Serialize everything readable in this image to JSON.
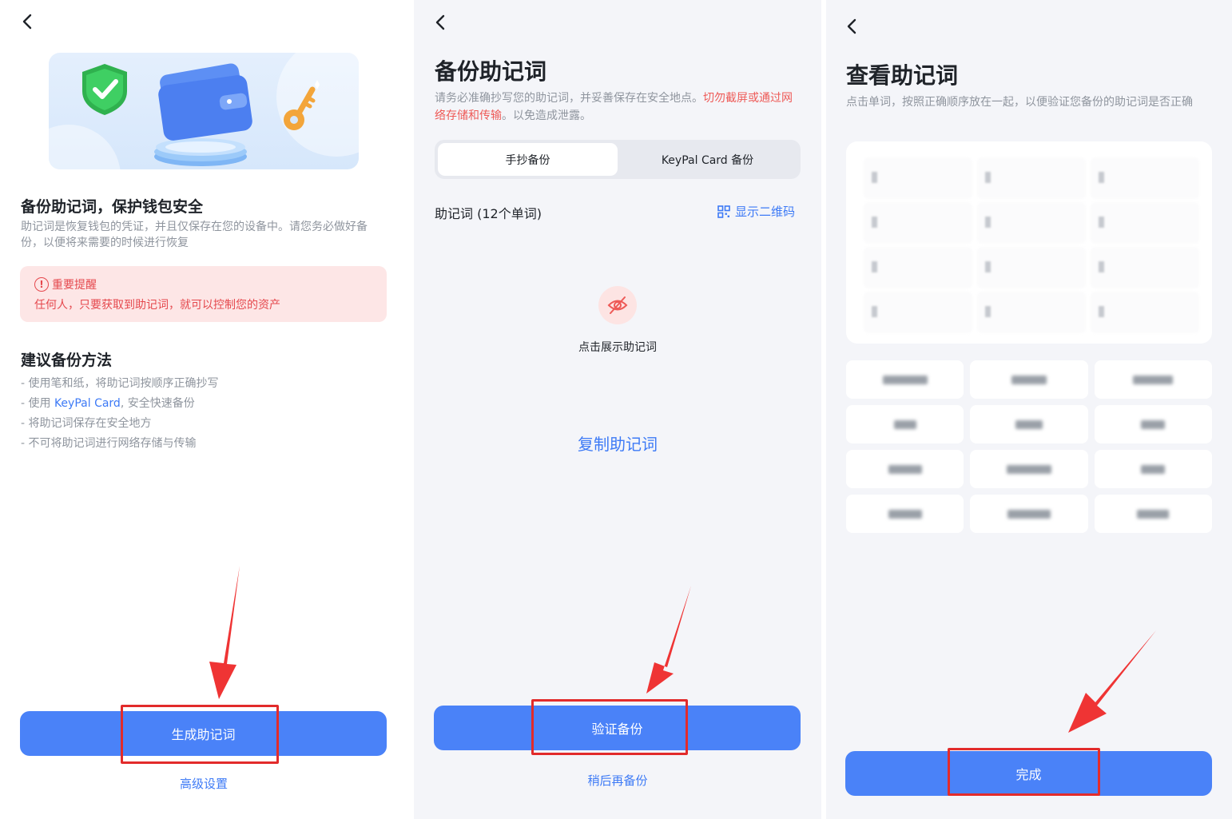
{
  "colors": {
    "accent": "#4a82f8",
    "link": "#3d7af6",
    "warning": "#e5484d",
    "highlight": "#e22b2b"
  },
  "screen1": {
    "back_icon": "chevron-left-icon",
    "title": "备份助记词，保护钱包安全",
    "description": "助记词是恢复钱包的凭证，并且仅保存在您的设备中。请您务必做好备份，以便将来需要的时候进行恢复",
    "warning": {
      "icon": "alert-circle-icon",
      "title": "重要提醒",
      "text": "任何人，只要获取到助记词，就可以控制您的资产"
    },
    "method_title": "建议备份方法",
    "tips": [
      "- 使用笔和纸，将助记词按顺序正确抄写",
      {
        "prefix": "- 使用 ",
        "link": "KeyPal Card",
        "suffix": ", 安全快速备份"
      },
      "- 将助记词保存在安全地方",
      "- 不可将助记词进行网络存储与传输"
    ],
    "primary_button": "生成助记词",
    "secondary_link": "高级设置"
  },
  "screen2": {
    "back_icon": "chevron-left-icon",
    "title": "备份助记词",
    "description": "请务必准确抄写您的助记词，并妥善保存在安全地点。",
    "description_warning": "切勿截屏或通过网络存储和传输",
    "description_tail": "。以免造成泄露。",
    "tabs": [
      {
        "label": "手抄备份",
        "active": true
      },
      {
        "label": "KeyPal Card 备份",
        "active": false
      }
    ],
    "mnemonic_label": "助记词 (12个单词)",
    "qr_link": "显示二维码",
    "qr_icon": "qr-code-icon",
    "reveal_icon": "eye-off-icon",
    "reveal_text": "点击展示助记词",
    "copy_link": "复制助记词",
    "primary_button": "验证备份",
    "secondary_link": "稍后再备份"
  },
  "screen3": {
    "back_icon": "chevron-left-icon",
    "title": "查看助记词",
    "description": "点击单词，按照正确顺序放在一起，以便验证您备份的助记词是否正确",
    "slot_count": 12,
    "chip_count": 12,
    "primary_button": "完成"
  }
}
